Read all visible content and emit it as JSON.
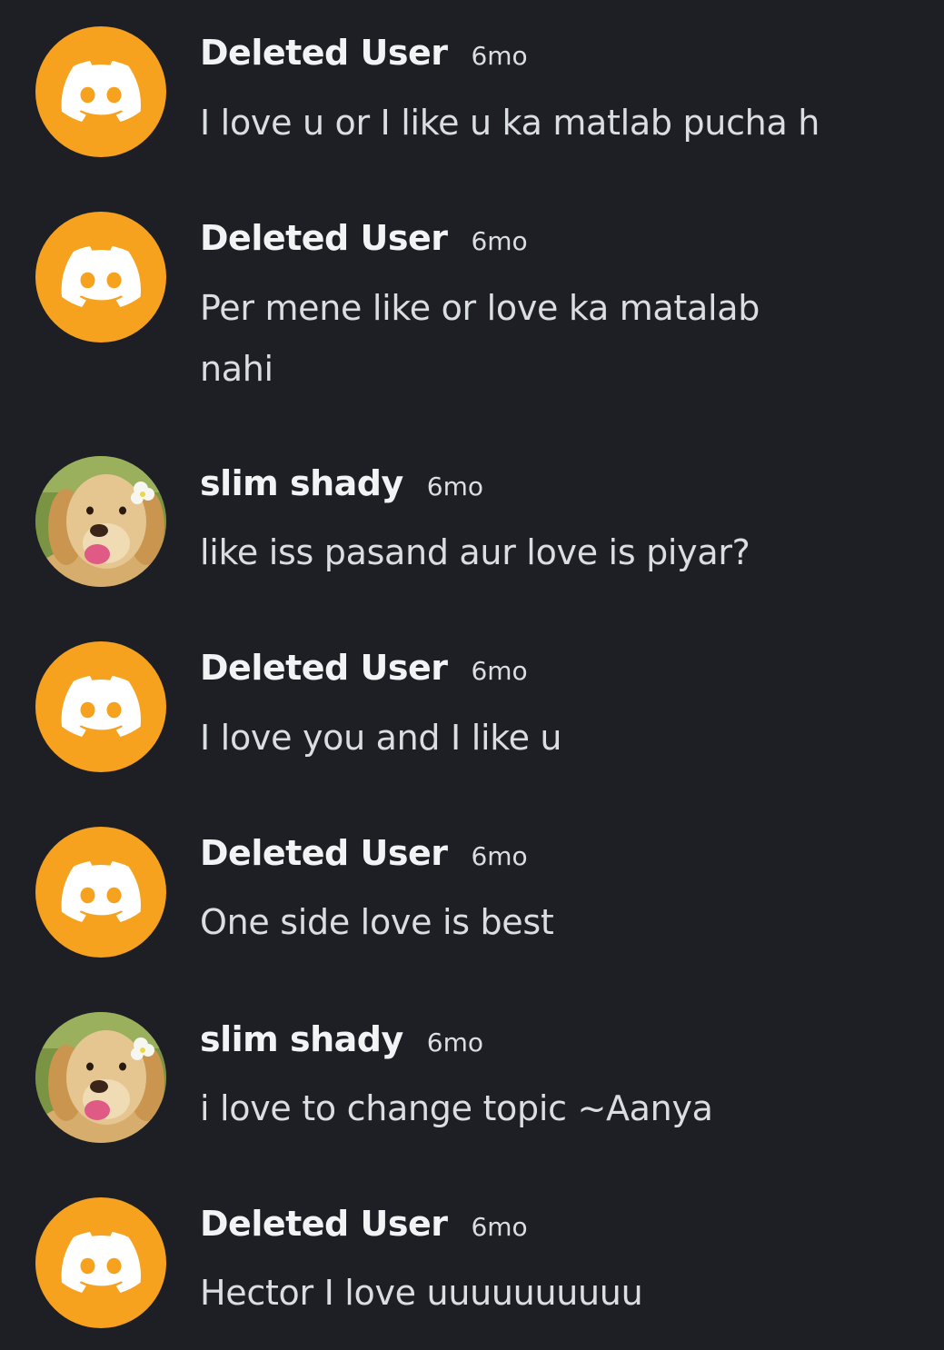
{
  "messages": [
    {
      "username": "Deleted User",
      "timestamp": "6mo",
      "text": "I love u or I like u ka matlab pucha h",
      "avatar": "discord-logo-icon"
    },
    {
      "username": "Deleted User",
      "timestamp": "6mo",
      "text": "Per mene like or love ka matalab nahi",
      "avatar": "discord-logo-icon"
    },
    {
      "username": "slim shady",
      "timestamp": "6mo",
      "text": "like iss pasand aur love is piyar?",
      "avatar": "dog-avatar"
    },
    {
      "username": "Deleted User",
      "timestamp": "6mo",
      "text": "I love you and I like u",
      "avatar": "discord-logo-icon"
    },
    {
      "username": "Deleted User",
      "timestamp": "6mo",
      "text": "One side love is best",
      "avatar": "discord-logo-icon"
    },
    {
      "username": "slim shady",
      "timestamp": "6mo",
      "text": "i love to change topic ~Aanya",
      "avatar": "dog-avatar"
    },
    {
      "username": "Deleted User",
      "timestamp": "6mo",
      "text": "Hector I love uuuuuuuuuu",
      "avatar": "discord-logo-icon"
    }
  ],
  "colors": {
    "background": "#1e1f24",
    "deleted_user_avatar": "#f6a21e",
    "username": "#f2f3f5",
    "message_text": "#dbdee1"
  }
}
